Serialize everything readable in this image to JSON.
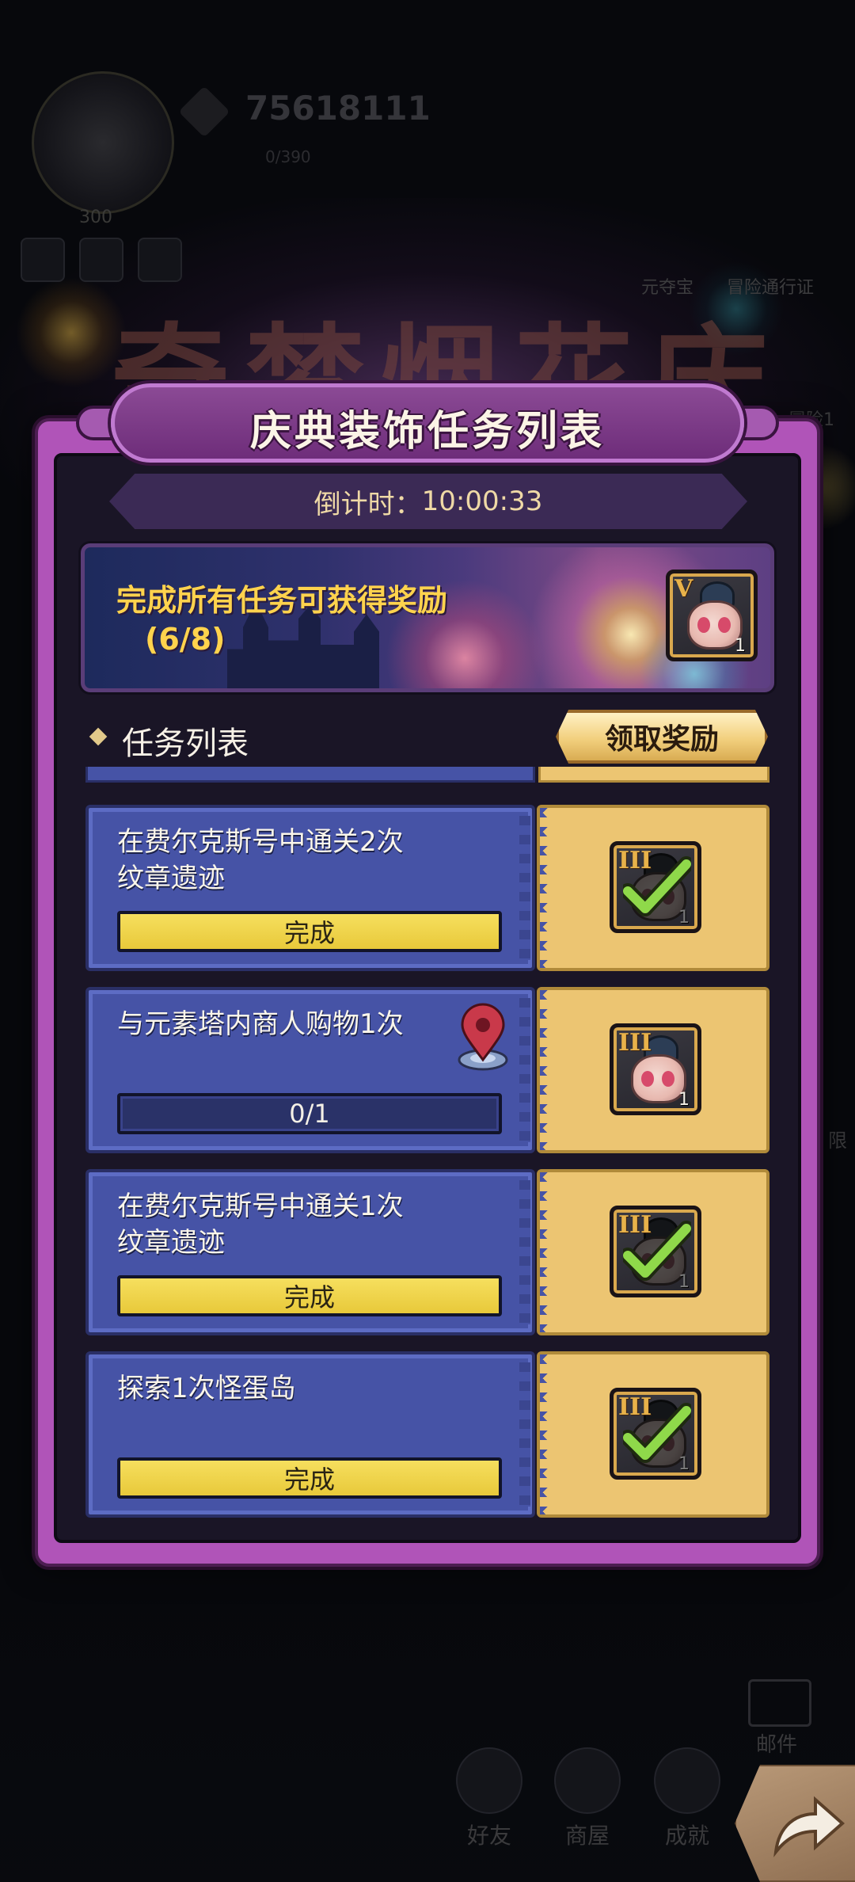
{
  "background": {
    "player_level": "300",
    "currency": "75618111",
    "sub_value": "0/390",
    "event_title": "奇梦烟花庆典",
    "side_labels": [
      "元夺宝",
      "冒险通行证",
      "冒险1",
      "限"
    ],
    "nav": [
      "好友",
      "商屋",
      "成就"
    ],
    "mail_label": "邮件"
  },
  "dialog": {
    "title": "庆典装饰任务列表",
    "countdown_label": "倒计时：",
    "countdown_value": "10:00:33",
    "banner": {
      "line1": "完成所有任务可获得奖励",
      "line2": "(6/8)",
      "reward": {
        "tier": "V",
        "qty": "1",
        "icon": "lucky-doll-icon"
      }
    },
    "section_label": "任务列表",
    "claim_button": "领取奖励",
    "tasks": [
      {
        "desc_line1": "在费尔克斯号中通关2次",
        "desc_line2": "纹章遗迹",
        "status": "完成",
        "done": true,
        "reward_tier": "III",
        "reward_qty": "1"
      },
      {
        "desc_line1": "与元素塔内商人购物1次",
        "desc_line2": "",
        "status": "0/1",
        "done": false,
        "reward_tier": "III",
        "reward_qty": "1",
        "has_location_pin": true
      },
      {
        "desc_line1": "在费尔克斯号中通关1次",
        "desc_line2": "纹章遗迹",
        "status": "完成",
        "done": true,
        "reward_tier": "III",
        "reward_qty": "1"
      },
      {
        "desc_line1": "探索1次怪蛋岛",
        "desc_line2": "",
        "status": "完成",
        "done": true,
        "reward_tier": "III",
        "reward_qty": "1"
      }
    ]
  },
  "colors": {
    "dialog_frame": "#b054b8",
    "task_panel": "#4653a6",
    "reward_panel": "#ecc572",
    "done_bar": "#f6df5e",
    "banner_text": "#ffd34d"
  }
}
